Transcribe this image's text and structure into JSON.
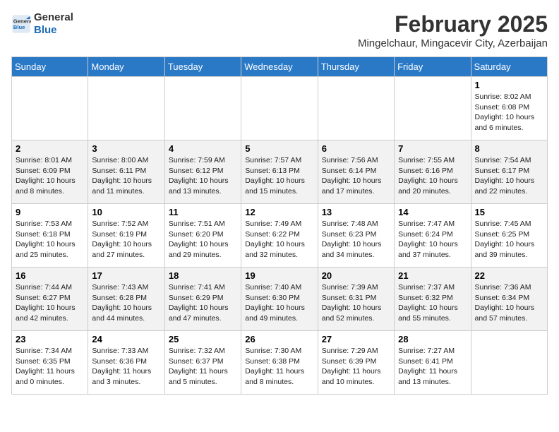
{
  "header": {
    "logo_line1": "General",
    "logo_line2": "Blue",
    "month_year": "February 2025",
    "location": "Mingelchaur, Mingacevir City, Azerbaijan"
  },
  "weekdays": [
    "Sunday",
    "Monday",
    "Tuesday",
    "Wednesday",
    "Thursday",
    "Friday",
    "Saturday"
  ],
  "weeks": [
    [
      {
        "day": "",
        "info": ""
      },
      {
        "day": "",
        "info": ""
      },
      {
        "day": "",
        "info": ""
      },
      {
        "day": "",
        "info": ""
      },
      {
        "day": "",
        "info": ""
      },
      {
        "day": "",
        "info": ""
      },
      {
        "day": "1",
        "info": "Sunrise: 8:02 AM\nSunset: 6:08 PM\nDaylight: 10 hours and 6 minutes."
      }
    ],
    [
      {
        "day": "2",
        "info": "Sunrise: 8:01 AM\nSunset: 6:09 PM\nDaylight: 10 hours and 8 minutes."
      },
      {
        "day": "3",
        "info": "Sunrise: 8:00 AM\nSunset: 6:11 PM\nDaylight: 10 hours and 11 minutes."
      },
      {
        "day": "4",
        "info": "Sunrise: 7:59 AM\nSunset: 6:12 PM\nDaylight: 10 hours and 13 minutes."
      },
      {
        "day": "5",
        "info": "Sunrise: 7:57 AM\nSunset: 6:13 PM\nDaylight: 10 hours and 15 minutes."
      },
      {
        "day": "6",
        "info": "Sunrise: 7:56 AM\nSunset: 6:14 PM\nDaylight: 10 hours and 17 minutes."
      },
      {
        "day": "7",
        "info": "Sunrise: 7:55 AM\nSunset: 6:16 PM\nDaylight: 10 hours and 20 minutes."
      },
      {
        "day": "8",
        "info": "Sunrise: 7:54 AM\nSunset: 6:17 PM\nDaylight: 10 hours and 22 minutes."
      }
    ],
    [
      {
        "day": "9",
        "info": "Sunrise: 7:53 AM\nSunset: 6:18 PM\nDaylight: 10 hours and 25 minutes."
      },
      {
        "day": "10",
        "info": "Sunrise: 7:52 AM\nSunset: 6:19 PM\nDaylight: 10 hours and 27 minutes."
      },
      {
        "day": "11",
        "info": "Sunrise: 7:51 AM\nSunset: 6:20 PM\nDaylight: 10 hours and 29 minutes."
      },
      {
        "day": "12",
        "info": "Sunrise: 7:49 AM\nSunset: 6:22 PM\nDaylight: 10 hours and 32 minutes."
      },
      {
        "day": "13",
        "info": "Sunrise: 7:48 AM\nSunset: 6:23 PM\nDaylight: 10 hours and 34 minutes."
      },
      {
        "day": "14",
        "info": "Sunrise: 7:47 AM\nSunset: 6:24 PM\nDaylight: 10 hours and 37 minutes."
      },
      {
        "day": "15",
        "info": "Sunrise: 7:45 AM\nSunset: 6:25 PM\nDaylight: 10 hours and 39 minutes."
      }
    ],
    [
      {
        "day": "16",
        "info": "Sunrise: 7:44 AM\nSunset: 6:27 PM\nDaylight: 10 hours and 42 minutes."
      },
      {
        "day": "17",
        "info": "Sunrise: 7:43 AM\nSunset: 6:28 PM\nDaylight: 10 hours and 44 minutes."
      },
      {
        "day": "18",
        "info": "Sunrise: 7:41 AM\nSunset: 6:29 PM\nDaylight: 10 hours and 47 minutes."
      },
      {
        "day": "19",
        "info": "Sunrise: 7:40 AM\nSunset: 6:30 PM\nDaylight: 10 hours and 49 minutes."
      },
      {
        "day": "20",
        "info": "Sunrise: 7:39 AM\nSunset: 6:31 PM\nDaylight: 10 hours and 52 minutes."
      },
      {
        "day": "21",
        "info": "Sunrise: 7:37 AM\nSunset: 6:32 PM\nDaylight: 10 hours and 55 minutes."
      },
      {
        "day": "22",
        "info": "Sunrise: 7:36 AM\nSunset: 6:34 PM\nDaylight: 10 hours and 57 minutes."
      }
    ],
    [
      {
        "day": "23",
        "info": "Sunrise: 7:34 AM\nSunset: 6:35 PM\nDaylight: 11 hours and 0 minutes."
      },
      {
        "day": "24",
        "info": "Sunrise: 7:33 AM\nSunset: 6:36 PM\nDaylight: 11 hours and 3 minutes."
      },
      {
        "day": "25",
        "info": "Sunrise: 7:32 AM\nSunset: 6:37 PM\nDaylight: 11 hours and 5 minutes."
      },
      {
        "day": "26",
        "info": "Sunrise: 7:30 AM\nSunset: 6:38 PM\nDaylight: 11 hours and 8 minutes."
      },
      {
        "day": "27",
        "info": "Sunrise: 7:29 AM\nSunset: 6:39 PM\nDaylight: 11 hours and 10 minutes."
      },
      {
        "day": "28",
        "info": "Sunrise: 7:27 AM\nSunset: 6:41 PM\nDaylight: 11 hours and 13 minutes."
      },
      {
        "day": "",
        "info": ""
      }
    ]
  ]
}
